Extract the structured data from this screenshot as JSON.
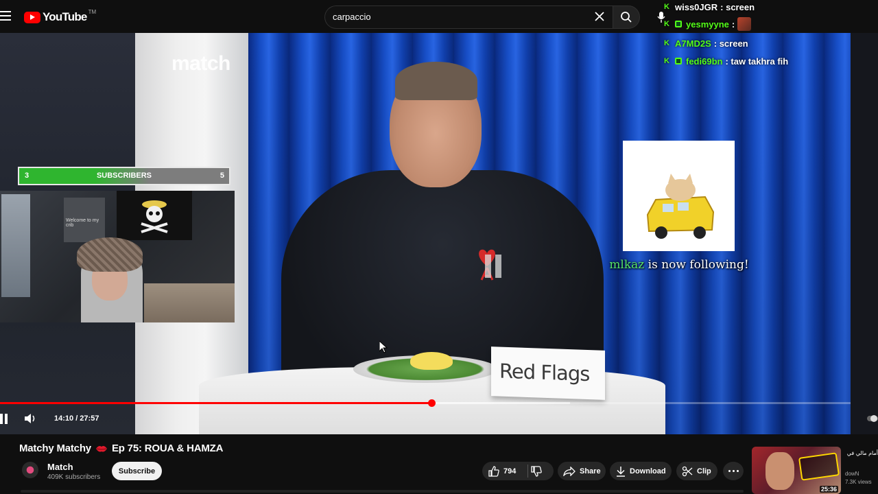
{
  "app": {
    "logo_text": "YouTube",
    "logo_tm": "TM"
  },
  "search": {
    "query": "carpaccio"
  },
  "video": {
    "brand_logo": "match",
    "name_card": "Red Flags",
    "time_display": "14:10 / 27:57",
    "progress": 0.507,
    "buffered": 0.67
  },
  "overlay": {
    "subs_goal": {
      "left_count": "3",
      "label": "SUBSCRIBERS",
      "right_count": "5"
    },
    "webcam_poster": "Welcome to my crib",
    "follow_alert": {
      "username": "mlkaz",
      "message": "is now following!"
    }
  },
  "chat": {
    "messages": [
      {
        "user": "wiss0JGR",
        "text": ": screen",
        "user_color": "#ffffff",
        "badge": "kick"
      },
      {
        "user": "yesmyyne",
        "text": ":",
        "user_color": "#ffffff",
        "badge": "sub",
        "emote": true
      },
      {
        "user": "A7MD2S",
        "text": ": screen",
        "user_color": "#53fc18",
        "badge": "kick"
      },
      {
        "user": "fedi69bn",
        "text": ": taw takhra fih",
        "user_color": "#53fc18",
        "badge": "sub"
      }
    ]
  },
  "info": {
    "title_part1": "Matchy Matchy",
    "title_part2": "Ep 75: ROUA & HAMZA",
    "channel_name": "Match",
    "channel_subs": "409K subscribers",
    "subscribe_label": "Subscribe",
    "likes": "794",
    "share_label": "Share",
    "download_label": "Download",
    "clip_label": "Clip"
  },
  "recommended": {
    "title": "أمام مالي في ♥ TN كاش",
    "channel": "dowN",
    "views": "7.3K views",
    "duration": "25:36"
  },
  "colors": {
    "accent": "#ff0000",
    "chat_green": "#53fc18",
    "follow_name": "#56e26a"
  }
}
